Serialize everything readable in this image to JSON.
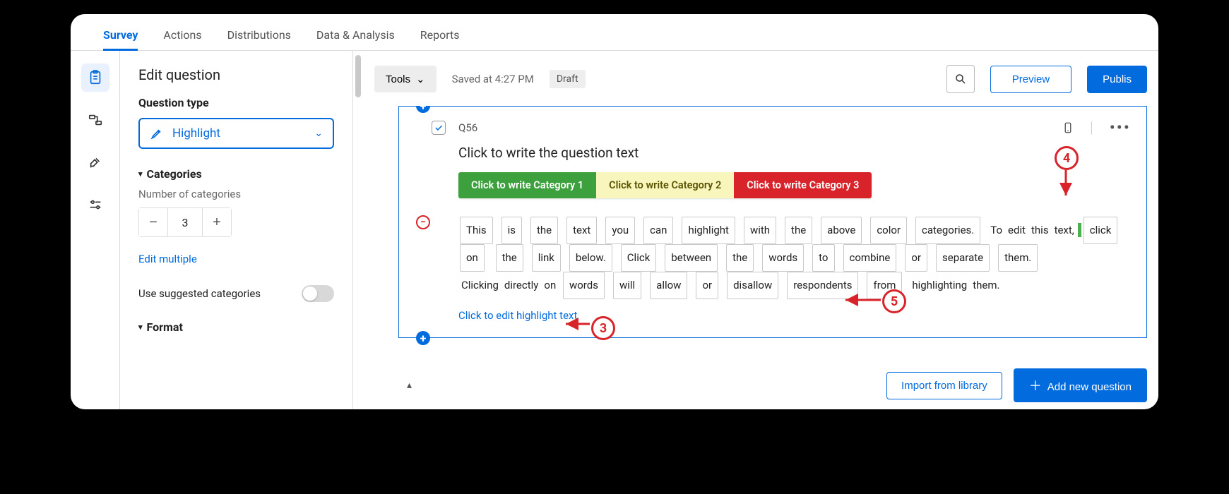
{
  "nav": {
    "tabs": [
      "Survey",
      "Actions",
      "Distributions",
      "Data & Analysis",
      "Reports"
    ],
    "active": 0
  },
  "side": {
    "title": "Edit question",
    "qtype_label": "Question type",
    "qtype_value": "Highlight",
    "categories_section": "Categories",
    "num_cat_label": "Number of categories",
    "num_cat_value": "3",
    "edit_multiple": "Edit multiple",
    "suggested_label": "Use suggested categories",
    "format_section": "Format"
  },
  "toolbar": {
    "tools": "Tools",
    "saved": "Saved at 4:27 PM",
    "draft": "Draft",
    "preview": "Preview",
    "publish": "Publis"
  },
  "question": {
    "id": "Q56",
    "prompt": "Click to write the question text",
    "categories": [
      "Click to write Category 1",
      "Click to write Category 2",
      "Click to write Category 3"
    ],
    "tokens_boxed_1": [
      "This",
      "is",
      "the",
      "text",
      "you",
      "can",
      "highlight",
      "with",
      "the",
      "above",
      "color",
      "categories."
    ],
    "tokens_plain_1": [
      "To",
      "edit",
      "this",
      "text,"
    ],
    "tokens_boxed_2": [
      "click",
      "on"
    ],
    "tokens_boxed_3": [
      "the",
      "link",
      "below.",
      "Click",
      "between",
      "the",
      "words",
      "to",
      "combine",
      "or",
      "separate",
      "them."
    ],
    "tokens_plain_2": [
      "Clicking",
      "directly",
      "on"
    ],
    "tokens_boxed_4": [
      "words",
      "will",
      "allow",
      "or",
      "disallow",
      "respondents",
      "from"
    ],
    "tokens_plain_3": [
      "highlighting",
      "them."
    ],
    "edit_link": "Click to edit highlight text"
  },
  "annotations": {
    "a3": "3",
    "a4": "4",
    "a5": "5"
  },
  "bottom": {
    "import": "Import from library",
    "add": "Add new question"
  }
}
